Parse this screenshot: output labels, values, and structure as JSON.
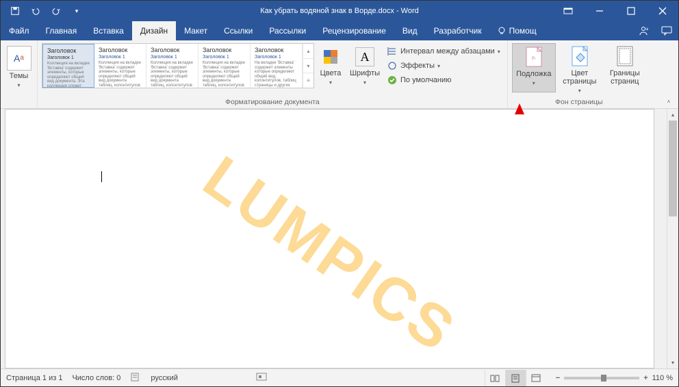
{
  "title": "Как убрать водяной знак в Ворде.docx - Word",
  "qat": {
    "save": "save",
    "undo": "undo",
    "redo": "redo",
    "custom": "custom"
  },
  "tabs": {
    "file": "Файл",
    "items": [
      "Главная",
      "Вставка",
      "Дизайн",
      "Макет",
      "Ссылки",
      "Рассылки",
      "Рецензирование",
      "Вид",
      "Разработчик"
    ],
    "active": "Дизайн",
    "help": "Помощ",
    "share": "Общий доступ"
  },
  "ribbon": {
    "themes": "Темы",
    "formatting_group": "Форматирование документа",
    "gallery": [
      {
        "title": "Заголовок",
        "sub": "Заголовок 1",
        "body": "Коллекция на вкладке 'Вставка' содержит элементы, которые определяют общий вид документа. Эта коллекция служит для вставки в документ"
      },
      {
        "title": "Заголовок",
        "sub": "Заголовок 1",
        "body": "Коллекция на вкладке 'Вставка' содержит элементы, которые определяют общий вид документа таблиц, колонтитулов"
      },
      {
        "title": "Заголовок",
        "sub": "Заголовок 1",
        "body": "Коллекция на вкладке 'Вставка' содержит элементы, которые определяют общий вид документа таблиц, колонтитулов"
      },
      {
        "title": "Заголовок",
        "sub": "Заголовок 1",
        "body": "Коллекция на вкладке 'Вставка' содержит элементы, которые определяют общий вид документа таблиц, колонтитулов"
      },
      {
        "title": "Заголовок",
        "sub": "Заголовок 1",
        "body": "На вкладке 'Вставка' содержит элементы которые определяют общий вид, колонтитулов, таблиц страницы и других"
      }
    ],
    "colors": "Цвета",
    "fonts": "Шрифты",
    "para_spacing": "Интервал между абзацами",
    "effects": "Эффекты",
    "default": "По умолчанию",
    "bg_group": "Фон страницы",
    "watermark_btn": "Подложка",
    "page_color": "Цвет страницы",
    "page_borders": "Границы страниц"
  },
  "doc": {
    "watermark": "LUMPICS"
  },
  "status": {
    "page": "Страница 1 из 1",
    "words": "Число слов: 0",
    "lang": "русский",
    "zoom": "110 %"
  }
}
